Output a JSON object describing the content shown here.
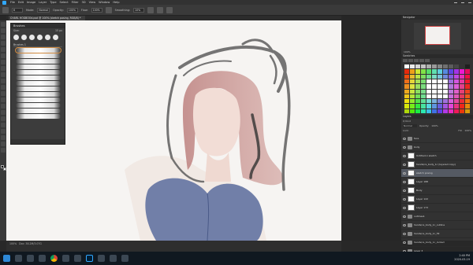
{
  "app": {
    "menu": [
      "File",
      "Edit",
      "Image",
      "Layer",
      "Type",
      "Select",
      "Filter",
      "3D",
      "View",
      "Window",
      "Help"
    ]
  },
  "options_bar": {
    "size": "6",
    "mode_label": "Mode:",
    "mode_value": "Normal",
    "opacity_label": "Opacity:",
    "opacity_value": "100%",
    "flow_label": "Flow:",
    "flow_value": "100%",
    "smoothing_label": "Smoothing:",
    "smoothing_value": "10%"
  },
  "document_tab": {
    "title": "CHARL HOGBOOd.psd @ 100% (sketch posing, RGB/8) *"
  },
  "brushes_panel": {
    "title": "Brushes",
    "size_label": "Size:",
    "size_value": "15 px",
    "group_name": "Brushes 1"
  },
  "navigator": {
    "title": "Navigator",
    "zoom": "100%"
  },
  "swatches": {
    "title": "Swatches"
  },
  "layers_panel": {
    "title": "Layers",
    "kind_label": "Q Kind",
    "blend_mode": "Normal",
    "opacity_label": "Opacity:",
    "opacity_value": "100%",
    "lock_label": "Lock:",
    "fill_label": "Fill:",
    "fill_value": "100%",
    "layers": [
      {
        "name": "face",
        "type": "folder"
      },
      {
        "name": "body",
        "type": "folder"
      },
      {
        "name": "Untitled-1 sketch",
        "type": "layer"
      },
      {
        "name": "hands/cs_body_1c (layered copy)",
        "type": "layer"
      },
      {
        "name": "sketch posing",
        "type": "layer",
        "selected": true
      },
      {
        "name": "Layer 188",
        "type": "layer"
      },
      {
        "name": "Body",
        "type": "layer"
      },
      {
        "name": "Layer 122",
        "type": "layer"
      },
      {
        "name": "Layer 173",
        "type": "layer"
      },
      {
        "name": "outlines1",
        "type": "folder"
      },
      {
        "name": "hands/cs_body_1c_outline",
        "type": "folder"
      },
      {
        "name": "hands/cs_body_1c_fill",
        "type": "folder"
      },
      {
        "name": "hands/cs_body_1c_locked",
        "type": "folder"
      },
      {
        "name": "Layer 3",
        "type": "folder"
      },
      {
        "name": "Layer 2",
        "type": "folder"
      }
    ]
  },
  "status_bar": {
    "zoom": "100%",
    "doc_info": "Doc: 38.2M/3.07G"
  },
  "taskbar": {
    "time": "2:40 PM",
    "date": "2020-03-19"
  },
  "colors": {
    "accent": "#31a8ff",
    "canvas": "#f6f4f2",
    "hair": "#c48a86",
    "dress": "#5b6c9e"
  }
}
